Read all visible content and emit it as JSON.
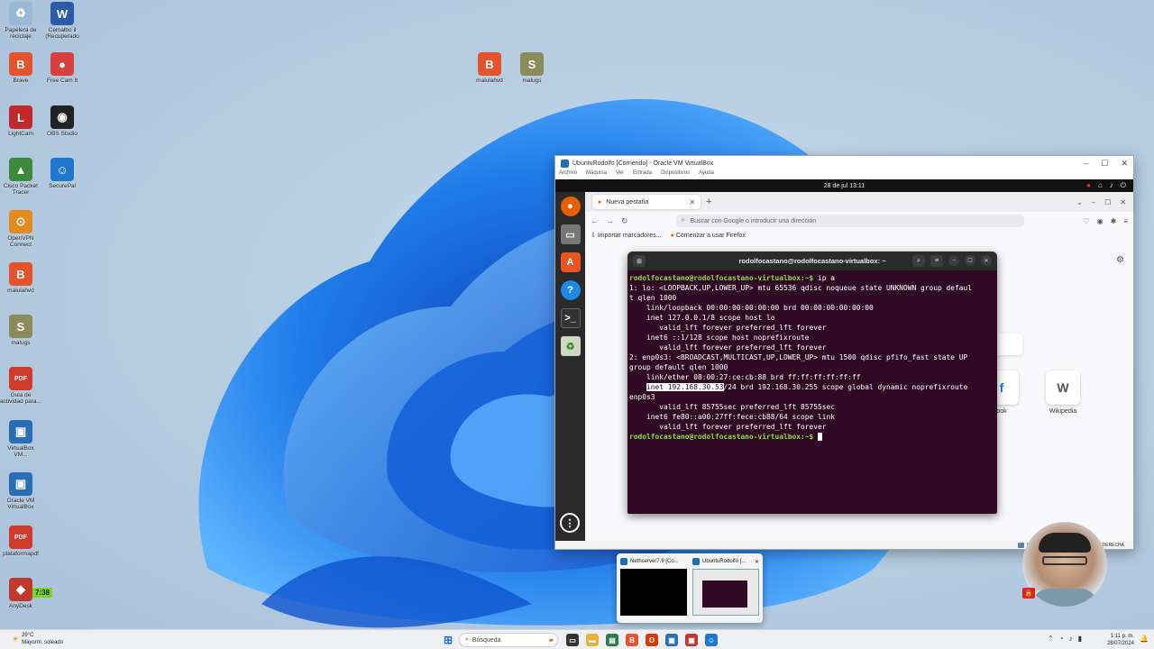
{
  "desktop_icons": [
    {
      "label": "Papelera de reciclaje",
      "icon": "recycle-bin-icon",
      "color": "#9ab8d8",
      "glyph": "♻"
    },
    {
      "label": "Cemalbo il (Recuperado a...",
      "icon": "word-document-icon",
      "color": "#2b5aa8",
      "glyph": "W"
    },
    {
      "label": "Brave",
      "icon": "brave-browser-icon",
      "color": "#e5532d",
      "glyph": "B"
    },
    {
      "label": "Free Cam 8",
      "icon": "free-cam-icon",
      "color": "#d84040",
      "glyph": "●"
    },
    {
      "label": "LightCam",
      "icon": "lightcam-icon",
      "color": "#c0282a",
      "glyph": "L"
    },
    {
      "label": "OBS Studio",
      "icon": "obs-studio-icon",
      "color": "#222222",
      "glyph": "◉"
    },
    {
      "label": "Cisco Packet Tracer",
      "icon": "cisco-packet-tracer-icon",
      "color": "#3a8a3a",
      "glyph": "▲"
    },
    {
      "label": "SecurePal",
      "icon": "securepal-icon",
      "color": "#1e78d0",
      "glyph": "☺"
    },
    {
      "label": "OpenVPN Connect",
      "icon": "openvpn-icon",
      "color": "#e58a1f",
      "glyph": "⊙"
    },
    {
      "label": "malulahvd",
      "icon": "brave-shortcut-icon",
      "color": "#e5532d",
      "glyph": "B"
    },
    {
      "label": "malugs",
      "icon": "script-file-icon",
      "color": "#8c8c5a",
      "glyph": "S"
    },
    {
      "label": "Guia de actividad para...",
      "icon": "pdf-file-icon",
      "color": "#d23b2a",
      "glyph": "PDF"
    },
    {
      "label": "VirtualBox VM...",
      "icon": "virtualbox-vm-icon",
      "color": "#2a6fb6",
      "glyph": "▣"
    },
    {
      "label": "Oracle VM VirtualBox",
      "icon": "virtualbox-icon",
      "color": "#2a6fb6",
      "glyph": "▣"
    },
    {
      "label": "plataformapdf",
      "icon": "pdf-file-icon",
      "color": "#d23b2a",
      "glyph": "PDF"
    },
    {
      "label": "AnyDesk",
      "icon": "anydesk-icon",
      "color": "#c0392b",
      "glyph": "◆"
    }
  ],
  "desktop_center_icons": [
    {
      "label": "malulahvd",
      "icon": "brave-shortcut-icon",
      "color": "#e5532d",
      "glyph": "B"
    },
    {
      "label": "malugs",
      "icon": "script-file-icon",
      "color": "#8c8c5a",
      "glyph": "S"
    }
  ],
  "widget_time": "7:38",
  "vm": {
    "title": "UbuntuRodolfo [Corriendo] - Oracle VM VirtualBox",
    "menu": [
      "Archivo",
      "Máquina",
      "Ver",
      "Entrada",
      "Dispositivos",
      "Ayuda"
    ],
    "status_right": "DERECHA",
    "guest_clock": "28 de jul  13:11"
  },
  "firefox": {
    "tab_title": "Nueva pestaña",
    "url_placeholder": "Buscar con Google o introducir una dirección",
    "bookmarks": [
      "Importar marcadores...",
      "Comenzar a usar Firefox"
    ],
    "shortcuts": [
      {
        "label": "ook",
        "glyph": "f",
        "color": "#1877f2"
      },
      {
        "label": "Wikipedia",
        "glyph": "W",
        "color": "#555555"
      }
    ]
  },
  "terminal": {
    "title": "rodolfocastano@rodolfocastano-virtualbox: ~",
    "prompt": "rodolfocastano@rodolfocastano-virtualbox:~$",
    "command": " ip a",
    "lines": [
      "1: lo: <LOOPBACK,UP,LOWER_UP> mtu 65536 qdisc noqueue state UNKNOWN group defaul",
      "t qlen 1000",
      "    link/loopback 00:00:00:00:00:00 brd 00:00:00:00:00:00",
      "    inet 127.0.0.1/8 scope host lo",
      "       valid_lft forever preferred_lft forever",
      "    inet6 ::1/128 scope host noprefixroute",
      "       valid_lft forever preferred_lft forever",
      "2: enp0s3: <BROADCAST,MULTICAST,UP,LOWER_UP> mtu 1500 qdisc pfifo_fast state UP",
      "group default qlen 1000",
      "    link/ether 08:00:27:ce:cb:88 brd ff:ff:ff:ff:ff:ff"
    ],
    "selected_text": "inet 192.168.30.53",
    "inet_rest": "/24 brd 192.168.30.255 scope global dynamic noprefixroute",
    "lines_after": [
      "enp0s3",
      "       valid_lft 85755sec preferred_lft 85755sec",
      "    inet6 fe80::a00:27ff:fece:cb88/64 scope link",
      "       valid_lft forever preferred_lft forever"
    ],
    "final_prompt": "rodolfocastano@rodolfocastano-virtualbox:~$"
  },
  "thumbnails": [
    {
      "title": "Nethserver7.9 [Co..."
    },
    {
      "title": "UbuntuRodolfo [..."
    }
  ],
  "taskbar": {
    "weather_temp": "29°C",
    "weather_desc": "Mayorm. soleado",
    "search_placeholder": "Búsqueda",
    "time": "1:11 p. m.",
    "date": "28/07/2024"
  }
}
